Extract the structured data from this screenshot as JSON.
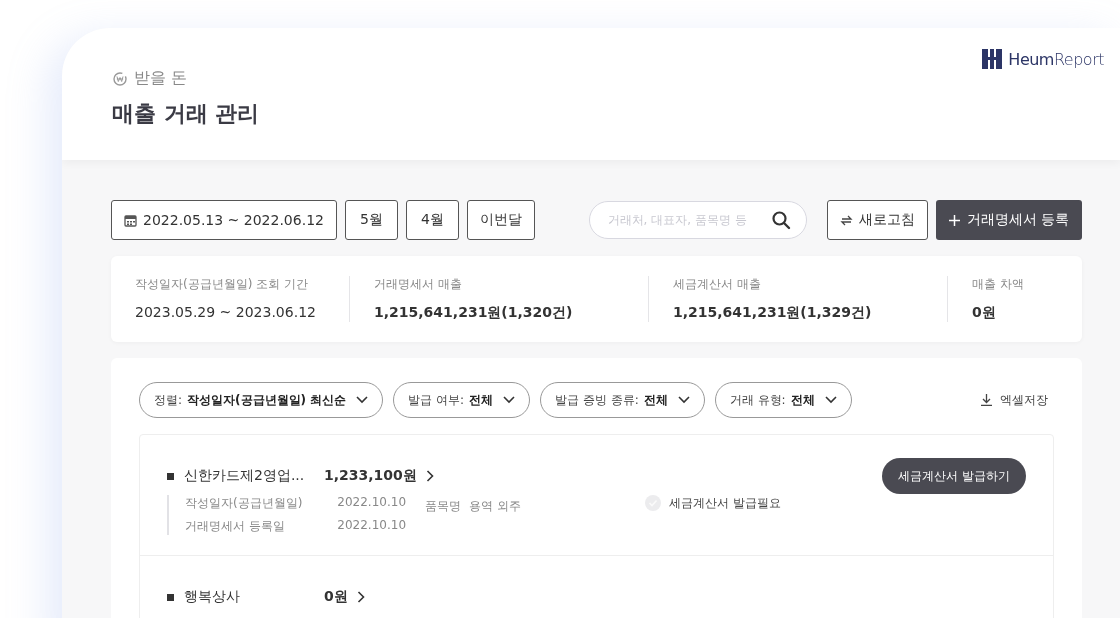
{
  "header": {
    "breadcrumb": "받을 돈",
    "title": "매출 거래 관리",
    "logo": {
      "bold": "Heum",
      "light": "Report"
    }
  },
  "toolbar": {
    "date_range": "2022.05.13 ~ 2022.06.12",
    "quick_ranges": [
      "5월",
      "4월",
      "이번달"
    ],
    "search": {
      "placeholder": "거래처, 대표자, 품목명 등"
    },
    "refresh": "새로고침",
    "register": "거래명세서 등록"
  },
  "summary": [
    {
      "label": "작성일자(공급년월일) 조회 기간",
      "value": "2023.05.29 ~ 2023.06.12",
      "kind": "period"
    },
    {
      "label": "거래명세서 매출",
      "value": "1,215,641,231원(1,320건)",
      "kind": "amount"
    },
    {
      "label": "세금계산서 매출",
      "value": "1,215,641,231원(1,329건)",
      "kind": "amount"
    },
    {
      "label": "매출 차액",
      "value": "0원",
      "kind": "amount"
    }
  ],
  "filters": [
    {
      "label": "정렬:",
      "value": "작성일자(공급년월일) 최신순"
    },
    {
      "label": "발급 여부:",
      "value": "전체"
    },
    {
      "label": "발급 증빙 종류:",
      "value": "전체"
    },
    {
      "label": "거래 유형:",
      "value": "전체"
    }
  ],
  "excel": "엑셀저장",
  "rows": [
    {
      "name": "신한카드제2영업...",
      "amount": "1,233,100원",
      "details": [
        {
          "label": "작성일자(공급년월일)",
          "value": "2022.10.10"
        },
        {
          "label": "거래명세서 등록일",
          "value": "2022.10.10"
        }
      ],
      "item_label": "품목명",
      "item_value": "용역 외주",
      "status": "세금계산서 발급필요",
      "issued": false,
      "action": "세금계산서 발급하기"
    },
    {
      "name": "행복상사",
      "amount": "0원"
    }
  ]
}
